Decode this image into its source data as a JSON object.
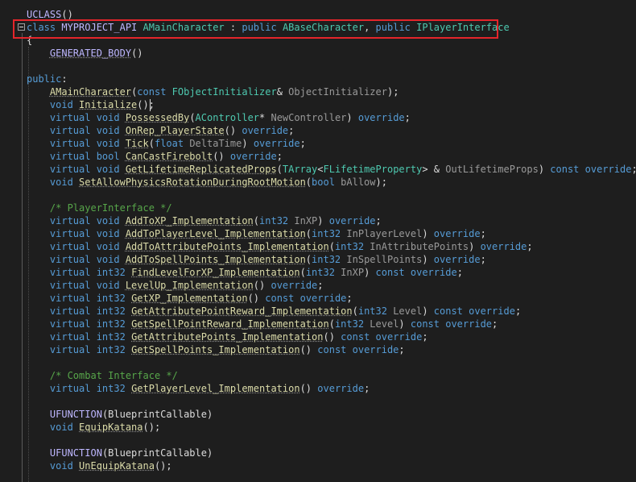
{
  "code_editor": {
    "lines": [
      [
        [
          "macro",
          "UCLASS"
        ],
        [
          "text",
          "()"
        ]
      ],
      [
        [
          "kw",
          "class "
        ],
        [
          "macro",
          "MYPROJECT_API "
        ],
        [
          "type",
          "AMainCharacter"
        ],
        [
          "text",
          " : "
        ],
        [
          "kw",
          "public "
        ],
        [
          "type",
          "ABaseCharacter"
        ],
        [
          "text",
          ", "
        ],
        [
          "kw",
          "public "
        ],
        [
          "type",
          "IPlayerInterface"
        ]
      ],
      [
        [
          "text",
          "{"
        ]
      ],
      [
        [
          "text",
          "    "
        ],
        [
          "macro",
          "GENERATED_BODY"
        ],
        [
          "text",
          "()"
        ]
      ],
      [],
      [
        [
          "kw",
          "public"
        ],
        [
          "text",
          ":"
        ]
      ],
      [
        [
          "text",
          "    "
        ],
        [
          "fn",
          "AMainCharacter"
        ],
        [
          "text",
          "("
        ],
        [
          "kw",
          "const "
        ],
        [
          "type",
          "FObjectInitializer"
        ],
        [
          "text",
          "& "
        ],
        [
          "param",
          "ObjectInitializer"
        ],
        [
          "text",
          ");"
        ]
      ],
      [
        [
          "text",
          "    "
        ],
        [
          "kw",
          "void "
        ],
        [
          "fn",
          "Initialize"
        ],
        [
          "text",
          "();"
        ]
      ],
      [
        [
          "text",
          "    "
        ],
        [
          "kw",
          "virtual void "
        ],
        [
          "fn",
          "PossessedBy"
        ],
        [
          "text",
          "("
        ],
        [
          "type",
          "AController"
        ],
        [
          "text",
          "* "
        ],
        [
          "param",
          "NewController"
        ],
        [
          "text",
          ") "
        ],
        [
          "kw",
          "override"
        ],
        [
          "text",
          ";"
        ]
      ],
      [
        [
          "text",
          "    "
        ],
        [
          "kw",
          "virtual void "
        ],
        [
          "fn",
          "OnRep_PlayerState"
        ],
        [
          "text",
          "() "
        ],
        [
          "kw",
          "override"
        ],
        [
          "text",
          ";"
        ]
      ],
      [
        [
          "text",
          "    "
        ],
        [
          "kw",
          "virtual void "
        ],
        [
          "fn",
          "Tick"
        ],
        [
          "text",
          "("
        ],
        [
          "kw",
          "float "
        ],
        [
          "param",
          "DeltaTime"
        ],
        [
          "text",
          ") "
        ],
        [
          "kw",
          "override"
        ],
        [
          "text",
          ";"
        ]
      ],
      [
        [
          "text",
          "    "
        ],
        [
          "kw",
          "virtual bool "
        ],
        [
          "fn",
          "CanCastFirebolt"
        ],
        [
          "text",
          "() "
        ],
        [
          "kw",
          "override"
        ],
        [
          "text",
          ";"
        ]
      ],
      [
        [
          "text",
          "    "
        ],
        [
          "kw",
          "virtual void "
        ],
        [
          "fn",
          "GetLifetimeReplicatedProps"
        ],
        [
          "text",
          "("
        ],
        [
          "type",
          "TArray"
        ],
        [
          "text",
          "<"
        ],
        [
          "type",
          "FLifetimeProperty"
        ],
        [
          "text",
          "> & "
        ],
        [
          "param",
          "OutLifetimeProps"
        ],
        [
          "text",
          ") "
        ],
        [
          "kw",
          "const override"
        ],
        [
          "text",
          ";"
        ]
      ],
      [
        [
          "text",
          "    "
        ],
        [
          "kw",
          "void "
        ],
        [
          "fn",
          "SetAllowPhysicsRotationDuringRootMotion"
        ],
        [
          "text",
          "("
        ],
        [
          "kw",
          "bool "
        ],
        [
          "param",
          "bAllow"
        ],
        [
          "text",
          ");"
        ]
      ],
      [],
      [
        [
          "text",
          "    "
        ],
        [
          "comment",
          "/* PlayerInterface */"
        ]
      ],
      [
        [
          "text",
          "    "
        ],
        [
          "kw",
          "virtual void "
        ],
        [
          "fn",
          "AddToXP_Implementation"
        ],
        [
          "text",
          "("
        ],
        [
          "kw",
          "int32 "
        ],
        [
          "param",
          "InXP"
        ],
        [
          "text",
          ") "
        ],
        [
          "kw",
          "override"
        ],
        [
          "text",
          ";"
        ]
      ],
      [
        [
          "text",
          "    "
        ],
        [
          "kw",
          "virtual void "
        ],
        [
          "fn",
          "AddToPlayerLevel_Implementation"
        ],
        [
          "text",
          "("
        ],
        [
          "kw",
          "int32 "
        ],
        [
          "param",
          "InPlayerLevel"
        ],
        [
          "text",
          ") "
        ],
        [
          "kw",
          "override"
        ],
        [
          "text",
          ";"
        ]
      ],
      [
        [
          "text",
          "    "
        ],
        [
          "kw",
          "virtual void "
        ],
        [
          "fn",
          "AddToAttributePoints_Implementation"
        ],
        [
          "text",
          "("
        ],
        [
          "kw",
          "int32 "
        ],
        [
          "param",
          "InAttributePoints"
        ],
        [
          "text",
          ") "
        ],
        [
          "kw",
          "override"
        ],
        [
          "text",
          ";"
        ]
      ],
      [
        [
          "text",
          "    "
        ],
        [
          "kw",
          "virtual void "
        ],
        [
          "fn",
          "AddToSpellPoints_Implementation"
        ],
        [
          "text",
          "("
        ],
        [
          "kw",
          "int32 "
        ],
        [
          "param",
          "InSpellPoints"
        ],
        [
          "text",
          ") "
        ],
        [
          "kw",
          "override"
        ],
        [
          "text",
          ";"
        ]
      ],
      [
        [
          "text",
          "    "
        ],
        [
          "kw",
          "virtual int32 "
        ],
        [
          "fn",
          "FindLevelForXP_Implementation"
        ],
        [
          "text",
          "("
        ],
        [
          "kw",
          "int32 "
        ],
        [
          "param",
          "InXP"
        ],
        [
          "text",
          ") "
        ],
        [
          "kw",
          "const override"
        ],
        [
          "text",
          ";"
        ]
      ],
      [
        [
          "text",
          "    "
        ],
        [
          "kw",
          "virtual void "
        ],
        [
          "fn",
          "LevelUp_Implementation"
        ],
        [
          "text",
          "() "
        ],
        [
          "kw",
          "override"
        ],
        [
          "text",
          ";"
        ]
      ],
      [
        [
          "text",
          "    "
        ],
        [
          "kw",
          "virtual int32 "
        ],
        [
          "fn",
          "GetXP_Implementation"
        ],
        [
          "text",
          "() "
        ],
        [
          "kw",
          "const override"
        ],
        [
          "text",
          ";"
        ]
      ],
      [
        [
          "text",
          "    "
        ],
        [
          "kw",
          "virtual int32 "
        ],
        [
          "fn",
          "GetAttributePointReward_Implementation"
        ],
        [
          "text",
          "("
        ],
        [
          "kw",
          "int32 "
        ],
        [
          "param",
          "Level"
        ],
        [
          "text",
          ") "
        ],
        [
          "kw",
          "const override"
        ],
        [
          "text",
          ";"
        ]
      ],
      [
        [
          "text",
          "    "
        ],
        [
          "kw",
          "virtual int32 "
        ],
        [
          "fn",
          "GetSpellPointReward_Implementation"
        ],
        [
          "text",
          "("
        ],
        [
          "kw",
          "int32 "
        ],
        [
          "param",
          "Level"
        ],
        [
          "text",
          ") "
        ],
        [
          "kw",
          "const override"
        ],
        [
          "text",
          ";"
        ]
      ],
      [
        [
          "text",
          "    "
        ],
        [
          "kw",
          "virtual int32 "
        ],
        [
          "fn",
          "GetAttributePoints_Implementation"
        ],
        [
          "text",
          "() "
        ],
        [
          "kw",
          "const override"
        ],
        [
          "text",
          ";"
        ]
      ],
      [
        [
          "text",
          "    "
        ],
        [
          "kw",
          "virtual int32 "
        ],
        [
          "fn",
          "GetSpellPoints_Implementation"
        ],
        [
          "text",
          "() "
        ],
        [
          "kw",
          "const override"
        ],
        [
          "text",
          ";"
        ]
      ],
      [],
      [
        [
          "text",
          "    "
        ],
        [
          "comment",
          "/* Combat Interface */"
        ]
      ],
      [
        [
          "text",
          "    "
        ],
        [
          "kw",
          "virtual int32 "
        ],
        [
          "fn",
          "GetPlayerLevel_Implementation"
        ],
        [
          "text",
          "() "
        ],
        [
          "kw",
          "override"
        ],
        [
          "text",
          ";"
        ]
      ],
      [],
      [
        [
          "text",
          "    "
        ],
        [
          "macro",
          "UFUNCTION"
        ],
        [
          "text",
          "(BlueprintCallable)"
        ]
      ],
      [
        [
          "text",
          "    "
        ],
        [
          "kw",
          "void "
        ],
        [
          "fn",
          "EquipKatana"
        ],
        [
          "text",
          "();"
        ]
      ],
      [],
      [
        [
          "text",
          "    "
        ],
        [
          "macro",
          "UFUNCTION"
        ],
        [
          "text",
          "(BlueprintCallable)"
        ]
      ],
      [
        [
          "text",
          "    "
        ],
        [
          "kw",
          "void "
        ],
        [
          "fn",
          "UnEquipKatana"
        ],
        [
          "text",
          "();"
        ]
      ]
    ]
  }
}
